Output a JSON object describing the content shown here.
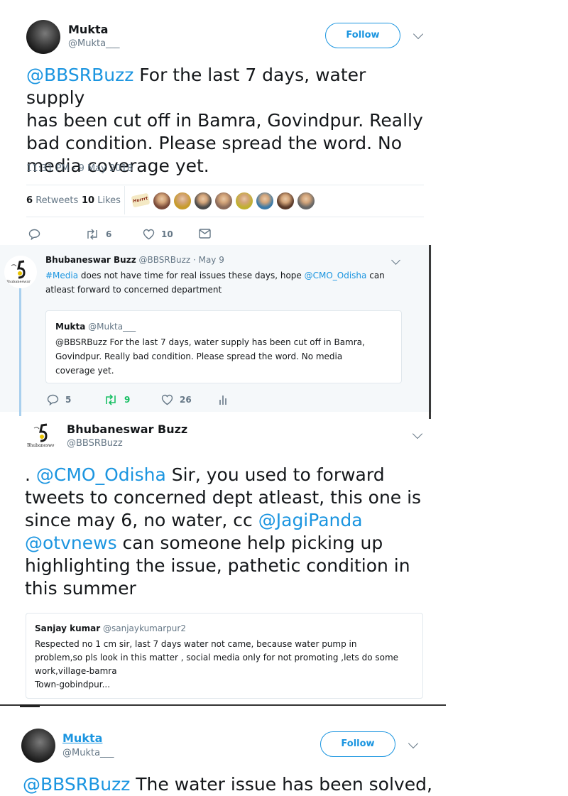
{
  "tweet1": {
    "name": "Mukta",
    "handle": "@Mukta___",
    "follow_label": "Follow",
    "mention": "@BBSRBuzz",
    "text_line1_rest": " For the last 7 days, water supply",
    "text_line2": "has been cut off in Bamra, Govindpur. Really",
    "text_line3": "bad condition. Please spread the word. No",
    "text_line4": "media coverage yet.",
    "timestamp": "11:31 PM - 9 May 2018",
    "retweets_count": "6",
    "retweets_label": "Retweets",
    "likes_count": "10",
    "likes_label": "Likes",
    "like_avatar_colors": [
      "#7a4b3a",
      "#c79b2a",
      "#4a4a4a",
      "#8a6a5a",
      "#c0b030",
      "#3c7aa8",
      "#5a3a2a",
      "#666666"
    ],
    "action_retweets": "6",
    "action_likes": "10",
    "liker_badge": "Hurrrt"
  },
  "tweet2": {
    "name": "Bhubaneswar Buzz",
    "handle_time": "@BBSRBuzz · May 9",
    "hashtag": "#Media",
    "text_line1_mid": " does not have time for real issues these days, hope ",
    "mention": "@CMO_Odisha",
    "text_line1_end": " can",
    "text_line2": "atleast forward to concerned department",
    "logo_caption": "Bhubaneswar",
    "quote": {
      "name": "Mukta",
      "handle": "@Mukta___",
      "line1": "@BBSRBuzz For the last 7 days, water supply has been cut off in Bamra,",
      "line2": "Govindpur. Really bad condition. Please spread the word. No media",
      "line3": "coverage yet."
    },
    "replies": "5",
    "retweets": "9",
    "likes": "26"
  },
  "tweet3": {
    "name": "Bhubaneswar Buzz",
    "handle": "@BBSRBuzz",
    "logo_caption": "Bhubaneswar",
    "line1_pre": ". ",
    "line1_mention": "@CMO_Odisha",
    "line1_rest": " Sir, you used to forward",
    "line2": "tweets to concerned dept atleast, this one is",
    "line3_pre": "since may 6, no water, cc ",
    "line3_mention": "@JagiPanda",
    "line4_mention": "@otvnews",
    "line4_rest": " can someone help picking up",
    "line5": "highlighting the issue, pathetic condition in",
    "line6": "this summer",
    "quote": {
      "name": "Sanjay kumar",
      "handle": "@sanjaykumarpur2",
      "line1": "Respected no 1 cm sir, last 7 days water not came, because  water pump in",
      "line2": "problem,so pls look in this matter , social media only for not promoting ,lets do some",
      "line3": "work,village-bamra",
      "line4": "Town-gobindpur..."
    }
  },
  "tweet4": {
    "name": "Mukta",
    "handle": "@Mukta___",
    "follow_label": "Follow",
    "mention": "@BBSRBuzz",
    "text_rest": " The water issue has been solved,"
  }
}
